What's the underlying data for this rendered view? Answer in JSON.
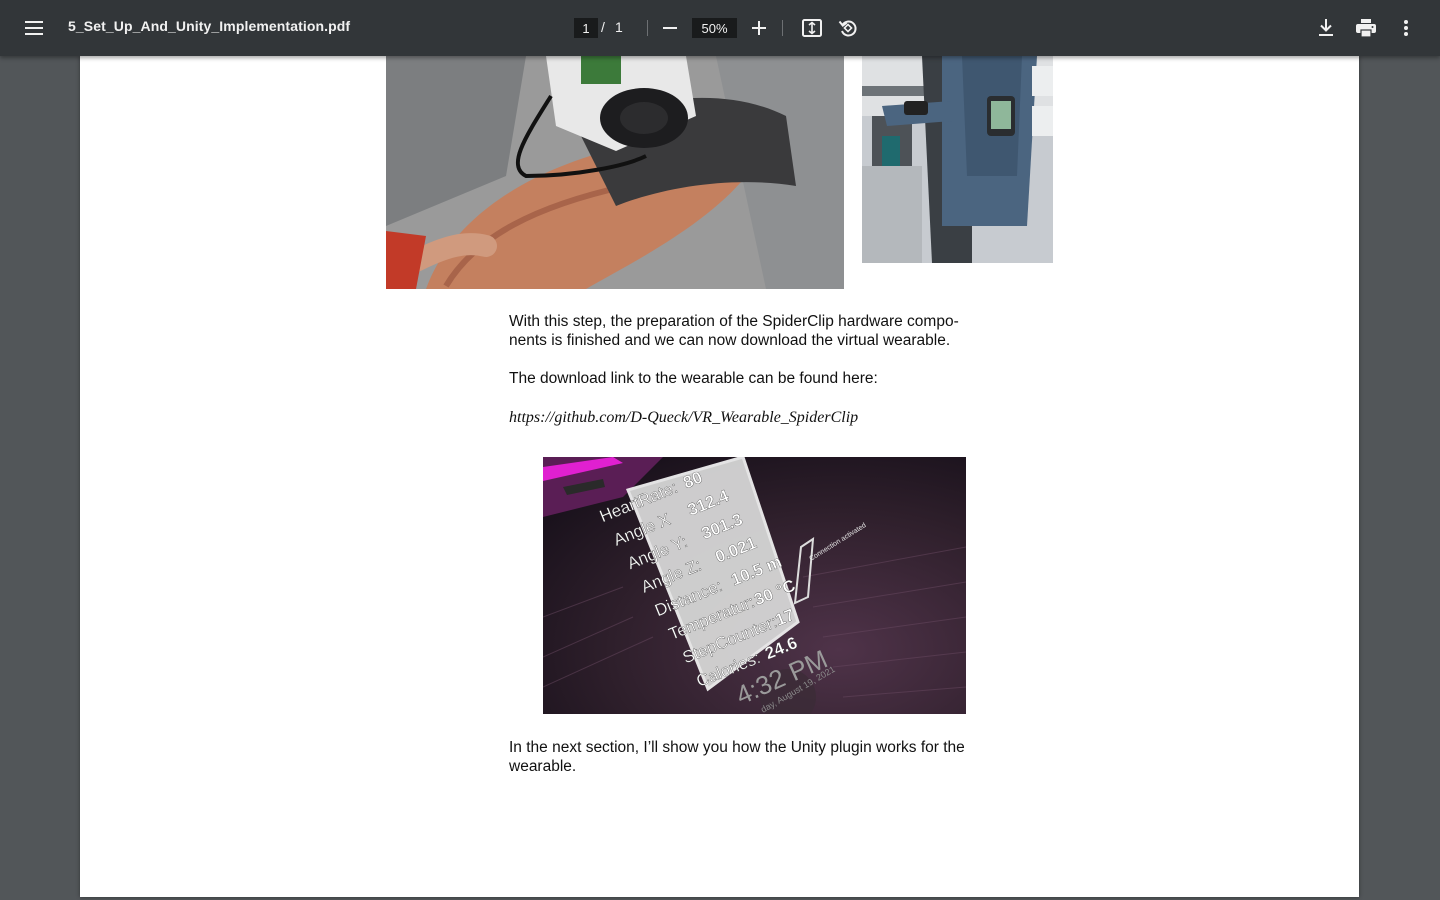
{
  "toolbar": {
    "file_name": "5_Set_Up_And_Unity_Implementation.pdf",
    "current_page": "1",
    "page_separator": "/",
    "total_pages": "1",
    "zoom": "50%"
  },
  "document": {
    "paragraphs": [
      "With this step, the preparation of the SpiderClip hardware compo-nents is finished and we can now download the virtual wearable.",
      "The download link to the wearable can be found here:",
      "https://github.com/D-Queck/VR_Wearable_SpiderClip",
      "In the next section, I’ll show you how the Unity plugin works for the wearable."
    ],
    "vr_panel": {
      "rows": [
        {
          "label": "HeartRate:",
          "value": "80"
        },
        {
          "label": "Angle X",
          "value": "312.4"
        },
        {
          "label": "Angle Y:",
          "value": "301.3"
        },
        {
          "label": "Angle Z:",
          "value": "0.021"
        },
        {
          "label": "Distance:",
          "value": "10.5",
          "unit": "m"
        },
        {
          "label": "Temperatur:",
          "value": "30",
          "unit": "°C"
        },
        {
          "label": "StepCounter:",
          "value": "17"
        },
        {
          "label": "Calories:",
          "value": "24.6"
        }
      ],
      "connection_text": "Connection activated",
      "clock_time": "4:32 PM",
      "clock_date": "day, August 19, 2021"
    }
  },
  "colors": {
    "toolbar_bg": "#323639",
    "viewer_bg": "#525659",
    "page_bg": "#ffffff",
    "vr_accent": "#e020d0"
  }
}
